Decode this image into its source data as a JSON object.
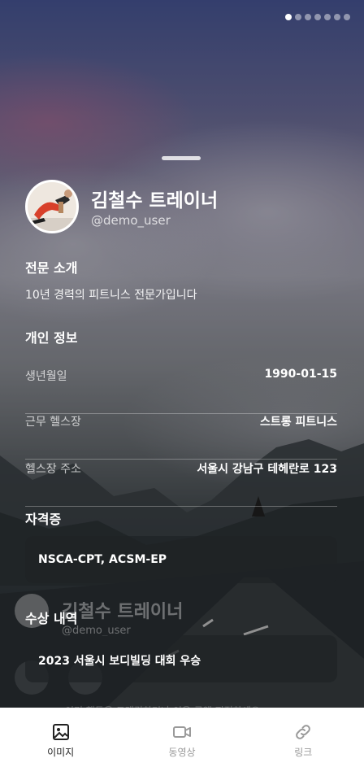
{
  "pagination": {
    "count": 7,
    "active_index": 0
  },
  "profile": {
    "name": "김철수 트레이너",
    "handle": "@demo_user"
  },
  "bio_section": {
    "title": "전문 소개",
    "text": "10년 경력의 피트니스 전문가입니다"
  },
  "personal_info": {
    "title": "개인 정보",
    "rows": [
      {
        "label": "생년월일",
        "value": "1990-01-15"
      },
      {
        "label": "근무 헬스장",
        "value": "스트롱 피트니스"
      },
      {
        "label": "헬스장 주소",
        "value": "서울시 강남구 테헤란로 123"
      }
    ]
  },
  "certifications": {
    "title": "자격증",
    "text": "NSCA-CPT, ACSM-EP"
  },
  "awards": {
    "title": "수상 내역",
    "text": "2023 서울시 보디빌딩 대회 우승"
  },
  "ghost_preview": {
    "name": "김철수 트레이너",
    "handle": "@demo_user",
    "text": "이미 행동을 트래킹하거나 이용 금액 지정하세요"
  },
  "tabs": [
    {
      "label": "이미지",
      "icon": "image-icon",
      "active": true
    },
    {
      "label": "동영상",
      "icon": "video-icon",
      "active": false
    },
    {
      "label": "링크",
      "icon": "link-icon",
      "active": false
    }
  ],
  "colors": {
    "tab_active": "#222222",
    "tab_inactive": "#9a9a9a",
    "card_bg": "#1e2226"
  }
}
